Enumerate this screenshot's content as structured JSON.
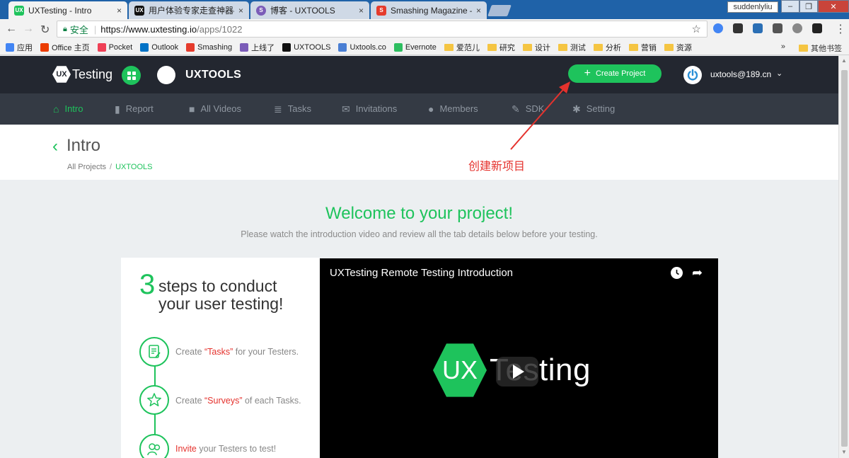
{
  "browser": {
    "tabs": [
      {
        "title": "UXTesting - Intro",
        "active": true
      },
      {
        "title": "用户体验专家走查神器—"
      },
      {
        "title": "博客 - UXTOOLS"
      },
      {
        "title": "Smashing Magazine –"
      }
    ],
    "close_glyph": "×",
    "profile_name": "suddenlyliu",
    "window_buttons": {
      "minimize": "–",
      "restore": "❐",
      "close": "✕"
    },
    "nav": {
      "back": "←",
      "forward": "→",
      "reload": "↻"
    },
    "secure_label": "安全",
    "url_host": "https://www.uxtesting.io",
    "url_path": "/apps/1022",
    "bookmark_star": "☆",
    "bookmarks": [
      {
        "label": "应用",
        "color": "#4285f4"
      },
      {
        "label": "Office 主页",
        "color": "#eb3c00"
      },
      {
        "label": "Pocket",
        "color": "#ef4056"
      },
      {
        "label": "Outlook",
        "color": "#0072c6"
      },
      {
        "label": "Smashing",
        "color": "#e53b2c"
      },
      {
        "label": "上线了",
        "color": "#7b5cb8"
      },
      {
        "label": "UXTOOLS",
        "color": "#111111"
      },
      {
        "label": "Uxtools.co",
        "color": "#4a7fd4"
      },
      {
        "label": "Evernote",
        "color": "#2dbe60"
      }
    ],
    "bookmark_folders": [
      "爱范儿",
      "研究",
      "设计",
      "测试",
      "分析",
      "营销",
      "资源"
    ],
    "bookmarks_more": "»",
    "other_bookmarks": "其他书签"
  },
  "header": {
    "logo_mark": "UX",
    "logo_text": "Testing",
    "project_name": "UXTOOLS",
    "create_button": "Create Project",
    "create_plus": "+",
    "user_email": "uxtools@189.cn",
    "caret": "⌄"
  },
  "subnav": {
    "items": [
      {
        "label": "Intro",
        "icon": "⌂",
        "active": true
      },
      {
        "label": "Report",
        "icon": "▮"
      },
      {
        "label": "All Videos",
        "icon": "■"
      },
      {
        "label": "Tasks",
        "icon": "≣"
      },
      {
        "label": "Invitations",
        "icon": "✉"
      },
      {
        "label": "Members",
        "icon": "●"
      },
      {
        "label": "SDK",
        "icon": "✎"
      },
      {
        "label": "Setting",
        "icon": "✱"
      }
    ]
  },
  "page": {
    "back_glyph": "‹",
    "title": "Intro",
    "breadcrumb": {
      "root": "All Projects",
      "separator": "/",
      "current": "UXTOOLS"
    },
    "annotation": "创建新项目",
    "welcome": "Welcome to your project!",
    "subtitle": "Please watch the introduction video and review all the tab details below before your testing."
  },
  "steps": {
    "number": "3",
    "heading_line1": "steps to conduct",
    "heading_line2": "your user testing!",
    "items": [
      {
        "before": "Create ",
        "highlight": "“Tasks”",
        "after": " for your Testers."
      },
      {
        "before": "Create ",
        "highlight": "“Surveys”",
        "after": " of each Tasks."
      },
      {
        "before": "",
        "highlight": "Invite",
        "after": " your Testers to test!"
      }
    ]
  },
  "video": {
    "title": "UXTesting Remote Testing Introduction",
    "logo_mark": "UX",
    "logo_word": "Testing",
    "share_glyph": "➦"
  },
  "scrollbar": {
    "up": "▲",
    "down": "▼"
  },
  "colors": {
    "brand_green": "#1ec35c",
    "annotation_red": "#e5322d",
    "header_dark": "#232730",
    "subnav_dark": "#343a44"
  }
}
